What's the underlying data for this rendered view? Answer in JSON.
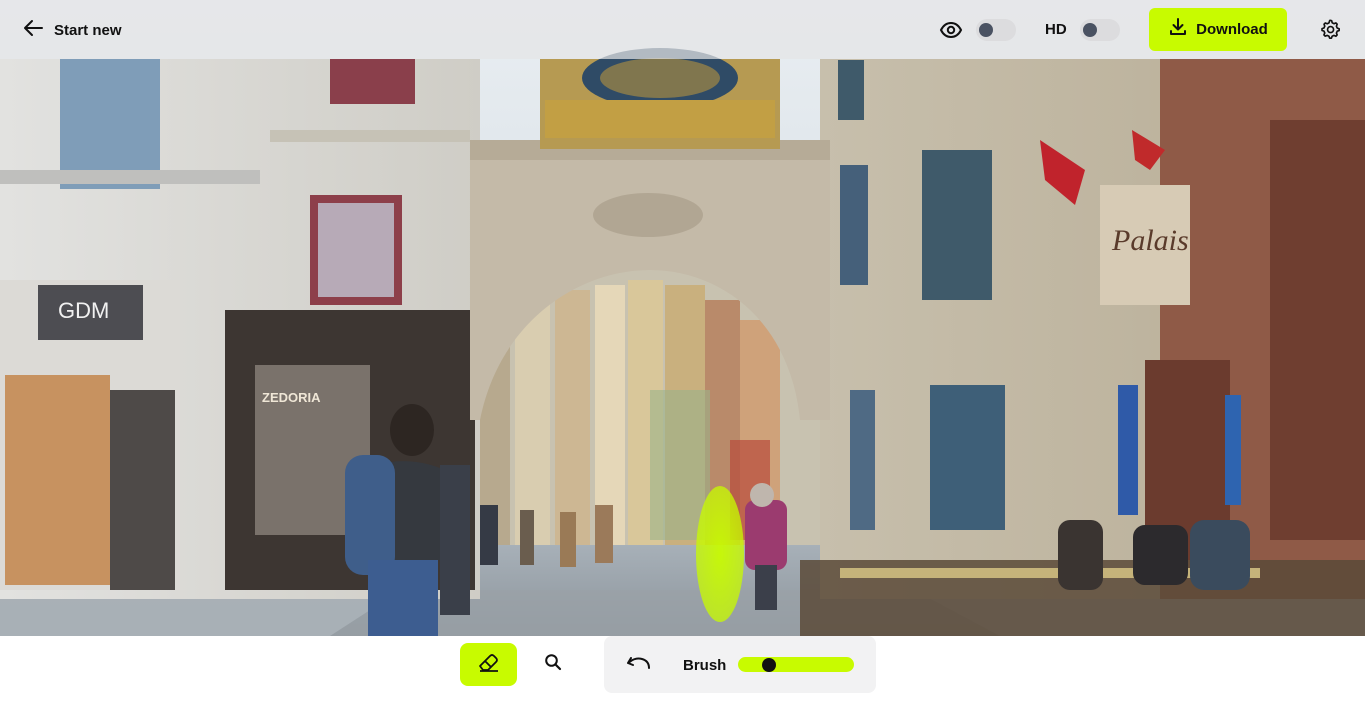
{
  "header": {
    "back_label": "Start new",
    "preview_toggle": {
      "icon": "eye-icon",
      "on": false
    },
    "hd_label": "HD",
    "hd_toggle": {
      "on": false
    },
    "download_label": "Download",
    "settings_icon": "gear-icon"
  },
  "canvas": {
    "image_subject": "street-photo-archway-clock",
    "mask_color": "#c8fb00"
  },
  "toolbar": {
    "eraser_icon": "eraser-icon",
    "zoom_icon": "magnifier-icon",
    "undo_icon": "undo-icon",
    "brush_label": "Brush",
    "brush_size_fraction": 0.24
  },
  "colors": {
    "accent": "#c8fb00",
    "topbar_bg": "#e4e4e6",
    "toggle_knob": "#4a5262"
  }
}
